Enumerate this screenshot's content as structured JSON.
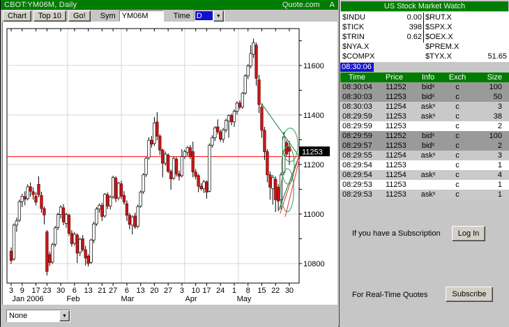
{
  "window": {
    "title": "CBOT:YM06M, Daily",
    "brand": "Quote.com",
    "brand_suffix": "A"
  },
  "toolbar": {
    "chart_button": "Chart",
    "top10_button": "Top 10",
    "go_button": "Go!",
    "sym_label": "Sym",
    "sym_value": "YM06M",
    "time_label": "Time",
    "time_value": "D"
  },
  "footer": {
    "indicator_value": "None"
  },
  "market_watch": {
    "title": "US Stock Market Watch",
    "rows": [
      [
        "$INDU",
        "0.00",
        "$RUT.X",
        ""
      ],
      [
        "$TICK",
        "398",
        "$SPX.X",
        ""
      ],
      [
        "$TRIN",
        "0.62",
        "$OEX.X",
        ""
      ],
      [
        "$NYA.X",
        "",
        "$PREM.X",
        ""
      ],
      [
        "$COMPX",
        "",
        "$TYX.X",
        "51.65"
      ]
    ],
    "time": "08:30:06"
  },
  "time_sales": {
    "columns": [
      "Time",
      "Price",
      "Info",
      "Exch",
      "Size"
    ],
    "rows": [
      [
        "08:30:04",
        "11252",
        "bidˣ",
        "c",
        "100",
        "dark"
      ],
      [
        "08:30:03",
        "11253",
        "bidˣ",
        "c",
        "50",
        "dark"
      ],
      [
        "08:30:03",
        "11254",
        "askˣ",
        "c",
        "3",
        "light"
      ],
      [
        "08:29:59",
        "11253",
        "askˣ",
        "c",
        "38",
        "light"
      ],
      [
        "08:29:59",
        "11253",
        "",
        "c",
        "2",
        "white"
      ],
      [
        "08:29:59",
        "11252",
        "bidˣ",
        "c",
        "100",
        "dark"
      ],
      [
        "08:29:57",
        "11253",
        "bidˣ",
        "c",
        "2",
        "dark"
      ],
      [
        "08:29:55",
        "11254",
        "askˣ",
        "c",
        "3",
        "light"
      ],
      [
        "08:29:54",
        "11253",
        "",
        "c",
        "1",
        "white"
      ],
      [
        "08:29:54",
        "11254",
        "askˣ",
        "c",
        "4",
        "light"
      ],
      [
        "08:29:53",
        "11253",
        "",
        "c",
        "1",
        "white"
      ],
      [
        "08:29:53",
        "11253",
        "askˣ",
        "c",
        "1",
        "light"
      ]
    ]
  },
  "subscription": {
    "login_text": "If you have a Subscription",
    "login_button": "Log In",
    "subscribe_text": "For Real-Time Quotes",
    "subscribe_button": "Subscribe"
  },
  "chart_data": {
    "type": "candlestick",
    "title": "CBOT:YM06M, Daily",
    "ylim": [
      10721,
      11749
    ],
    "yticks_labeled": [
      10800,
      11000,
      11200,
      11400,
      11600
    ],
    "ytick_minor_step": 100,
    "last_price": "11253",
    "hline": {
      "price": 11232,
      "color": "#ff0000"
    },
    "grid": true,
    "grid_color": "#d4d4d4",
    "up_color": "#ffffff",
    "down_color": "#c41a1a",
    "vgrid_i": [
      20.5,
      40,
      63,
      82.5
    ],
    "xticks": [
      {
        "label": "3",
        "i": 0
      },
      {
        "label": "9",
        "i": 4
      },
      {
        "label": "17",
        "i": 9
      },
      {
        "label": "23",
        "i": 13
      },
      {
        "label": "30",
        "i": 18
      },
      {
        "label": "6",
        "i": 23
      },
      {
        "label": "13",
        "i": 28
      },
      {
        "label": "21",
        "i": 33
      },
      {
        "label": "27",
        "i": 37
      },
      {
        "label": "6",
        "i": 42
      },
      {
        "label": "13",
        "i": 47
      },
      {
        "label": "20",
        "i": 52
      },
      {
        "label": "27",
        "i": 57
      },
      {
        "label": "3",
        "i": 62
      },
      {
        "label": "10",
        "i": 67
      },
      {
        "label": "17",
        "i": 71
      },
      {
        "label": "24",
        "i": 76
      },
      {
        "label": "1",
        "i": 81
      },
      {
        "label": "8",
        "i": 86
      },
      {
        "label": "15",
        "i": 91
      },
      {
        "label": "22",
        "i": 96
      },
      {
        "label": "30",
        "i": 101
      }
    ],
    "months": [
      {
        "label": "Jan 2006",
        "x": 36
      },
      {
        "label": "Feb",
        "x": 101
      },
      {
        "label": "Mar",
        "x": 179
      },
      {
        "label": "Apr",
        "x": 270
      },
      {
        "label": "May",
        "x": 346
      }
    ],
    "trendlines": [
      {
        "color": "#1e7a3c",
        "i1": 91,
        "p1": 11445,
        "i2": 104.5,
        "p2": 11234
      },
      {
        "color": "#1e7a3c",
        "i1": 97.2,
        "p1": 11017,
        "i2": 104.5,
        "p2": 11234
      },
      {
        "color": "#e03030",
        "i1": 97.7,
        "p1": 11003,
        "i2": 105,
        "p2": 11248
      },
      {
        "color": "#e03030",
        "i1": 99.5,
        "p1": 10989,
        "i2": 105,
        "p2": 11237
      }
    ],
    "ellipses": [
      {
        "i": 101.3,
        "p": 11279,
        "ri": 2.8,
        "rp": 68
      },
      {
        "i": 100.5,
        "p": 11197,
        "ri": 2.3,
        "rp": 76
      },
      {
        "i": 100.3,
        "p": 11096,
        "ri": 2.3,
        "rp": 87
      }
    ],
    "candles": [
      [
        "Jan 3",
        10850,
        10865,
        10798,
        10812
      ],
      [
        "Jan 4",
        10818,
        10962,
        10812,
        10955
      ],
      [
        "Jan 5",
        10955,
        10985,
        10928,
        10972
      ],
      [
        "Jan 6",
        10975,
        11058,
        10968,
        11050
      ],
      [
        "Jan 9",
        11050,
        11082,
        11028,
        11072
      ],
      [
        "Jan 10",
        11070,
        11092,
        11035,
        11060
      ],
      [
        "Jan 11",
        11062,
        11120,
        11055,
        11110
      ],
      [
        "Jan 12",
        11110,
        11128,
        11070,
        11092
      ],
      [
        "Jan 13",
        11090,
        11108,
        11058,
        11078
      ],
      [
        "Jan 17",
        11072,
        11088,
        11035,
        11048
      ],
      [
        "Jan 18",
        11120,
        11152,
        11068,
        11078
      ],
      [
        "Jan 19",
        11075,
        11090,
        11005,
        11022
      ],
      [
        "Jan 20",
        11022,
        11030,
        10958,
        10996
      ],
      [
        "Jan 23",
        10928,
        10935,
        10752,
        10768
      ],
      [
        "Jan 24",
        10836,
        10848,
        10790,
        10804
      ],
      [
        "Jan 25",
        10806,
        10884,
        10798,
        10876
      ],
      [
        "Jan 26",
        10878,
        10952,
        10868,
        10944
      ],
      [
        "Jan 27",
        10946,
        11005,
        10935,
        10998
      ],
      [
        "Jan 30",
        10998,
        11035,
        10982,
        11028
      ],
      [
        "Jan 31",
        11025,
        11040,
        10955,
        10968
      ],
      [
        "Feb 1",
        10962,
        11005,
        10945,
        10998
      ],
      [
        "Feb 2",
        10995,
        11002,
        10912,
        10922
      ],
      [
        "Feb 3",
        10922,
        10935,
        10868,
        10880
      ],
      [
        "Feb 6",
        10882,
        10928,
        10872,
        10918
      ],
      [
        "Feb 7",
        10915,
        10922,
        10802,
        10842
      ],
      [
        "Feb 8",
        10845,
        10905,
        10830,
        10898
      ],
      [
        "Feb 9",
        10900,
        10915,
        10848,
        10856
      ],
      [
        "Feb 10",
        10856,
        10872,
        10792,
        10822
      ],
      [
        "Feb 13",
        10830,
        10838,
        10788,
        10800
      ],
      [
        "Feb 14",
        10805,
        10900,
        10798,
        10895
      ],
      [
        "Feb 15",
        10895,
        10968,
        10882,
        10960
      ],
      [
        "Feb 16",
        10960,
        11028,
        10952,
        11020
      ],
      [
        "Feb 17",
        11020,
        11042,
        11005,
        11035
      ],
      [
        "Feb 21",
        11035,
        11045,
        10972,
        10990
      ],
      [
        "Feb 22",
        10992,
        11085,
        10985,
        11080
      ],
      [
        "Feb 23",
        11078,
        11088,
        11020,
        11032
      ],
      [
        "Feb 24",
        11032,
        11075,
        11018,
        11068
      ],
      [
        "Feb 27",
        11070,
        11155,
        11062,
        11148
      ],
      [
        "Feb 28",
        11145,
        11152,
        11048,
        11062
      ],
      [
        "Mar 1",
        11065,
        11130,
        11055,
        11125
      ],
      [
        "Mar 2",
        11122,
        11135,
        11060,
        11072
      ],
      [
        "Mar 3",
        11075,
        11092,
        11038,
        11048
      ],
      [
        "Mar 6",
        11042,
        11055,
        10972,
        10995
      ],
      [
        "Mar 7",
        10995,
        11005,
        10938,
        10958
      ],
      [
        "Mar 8",
        10955,
        10995,
        10918,
        10988
      ],
      [
        "Mar 9",
        10992,
        11005,
        10940,
        10948
      ],
      [
        "Mar 10",
        10950,
        11038,
        10942,
        11030
      ],
      [
        "Mar 13",
        11032,
        11095,
        11025,
        11088
      ],
      [
        "Mar 14",
        11090,
        11165,
        11082,
        11158
      ],
      [
        "Mar 15",
        11160,
        11230,
        11150,
        11225
      ],
      [
        "Mar 16",
        11228,
        11310,
        11220,
        11298
      ],
      [
        "Mar 17",
        11298,
        11315,
        11268,
        11282
      ],
      [
        "Mar 20",
        11285,
        11392,
        11275,
        11368
      ],
      [
        "Mar 21",
        11372,
        11412,
        11298,
        11315
      ],
      [
        "Mar 22",
        11315,
        11322,
        11238,
        11258
      ],
      [
        "Mar 23",
        11258,
        11265,
        11148,
        11205
      ],
      [
        "Mar 24",
        11205,
        11252,
        11195,
        11242
      ],
      [
        "Mar 27",
        11238,
        11245,
        11165,
        11172
      ],
      [
        "Mar 28",
        11172,
        11180,
        11098,
        11142
      ],
      [
        "Mar 29",
        11145,
        11232,
        11138,
        11225
      ],
      [
        "Mar 30",
        11222,
        11230,
        11152,
        11162
      ],
      [
        "Mar 31",
        11162,
        11175,
        11135,
        11152
      ],
      [
        "Apr 3",
        11155,
        11262,
        11148,
        11232
      ],
      [
        "Apr 4",
        11232,
        11260,
        11222,
        11252
      ],
      [
        "Apr 5",
        11250,
        11275,
        11235,
        11268
      ],
      [
        "Apr 6",
        11268,
        11278,
        11222,
        11232
      ],
      [
        "Apr 7",
        11252,
        11292,
        11148,
        11170
      ],
      [
        "Apr 10",
        11170,
        11182,
        11140,
        11152
      ],
      [
        "Apr 11",
        11155,
        11162,
        11088,
        11112
      ],
      [
        "Apr 12",
        11112,
        11125,
        11095,
        11102
      ],
      [
        "Apr 13",
        11102,
        11138,
        11085,
        11130
      ],
      [
        "Apr 17",
        11130,
        11135,
        11062,
        11088
      ],
      [
        "Apr 18",
        11092,
        11285,
        11088,
        11278
      ],
      [
        "Apr 19",
        11278,
        11318,
        11268,
        11308
      ],
      [
        "Apr 20",
        11308,
        11355,
        11295,
        11348
      ],
      [
        "Apr 21",
        11352,
        11382,
        11322,
        11332
      ],
      [
        "Apr 24",
        11332,
        11340,
        11292,
        11302
      ],
      [
        "Apr 25",
        11302,
        11348,
        11288,
        11340
      ],
      [
        "Apr 26",
        11340,
        11385,
        11330,
        11378
      ],
      [
        "Apr 27",
        11375,
        11402,
        11308,
        11398
      ],
      [
        "Apr 28",
        11398,
        11405,
        11358,
        11372
      ],
      [
        "May 1",
        11372,
        11422,
        11352,
        11415
      ],
      [
        "May 2",
        11415,
        11455,
        11402,
        11448
      ],
      [
        "May 3",
        11448,
        11458,
        11422,
        11432
      ],
      [
        "May 4",
        11432,
        11492,
        11425,
        11488
      ],
      [
        "May 5",
        11488,
        11565,
        11482,
        11558
      ],
      [
        "May 8",
        11558,
        11605,
        11545,
        11598
      ],
      [
        "May 9",
        11598,
        11682,
        11588,
        11648
      ],
      [
        "May 10",
        11645,
        11708,
        11630,
        11692
      ],
      [
        "May 11",
        11682,
        11692,
        11518,
        11548
      ],
      [
        "May 12",
        11542,
        11562,
        11408,
        11442
      ],
      [
        "May 15",
        11432,
        11448,
        11308,
        11338
      ],
      [
        "May 16",
        11338,
        11352,
        11218,
        11252
      ],
      [
        "May 17",
        11252,
        11262,
        11128,
        11158
      ],
      [
        "May 18",
        11158,
        11172,
        11058,
        11108
      ],
      [
        "May 19",
        11102,
        11158,
        11038,
        11148
      ],
      [
        "May 22",
        11140,
        11152,
        11008,
        11058
      ],
      [
        "May 23",
        11108,
        11120,
        11012,
        11052
      ],
      [
        "May 24",
        11058,
        11168,
        11018,
        11158
      ],
      [
        "May 25",
        11168,
        11332,
        11158,
        11312
      ],
      [
        "May 26",
        11288,
        11298,
        11232,
        11242
      ],
      [
        "May 30",
        11272,
        11295,
        11198,
        11253
      ]
    ]
  }
}
